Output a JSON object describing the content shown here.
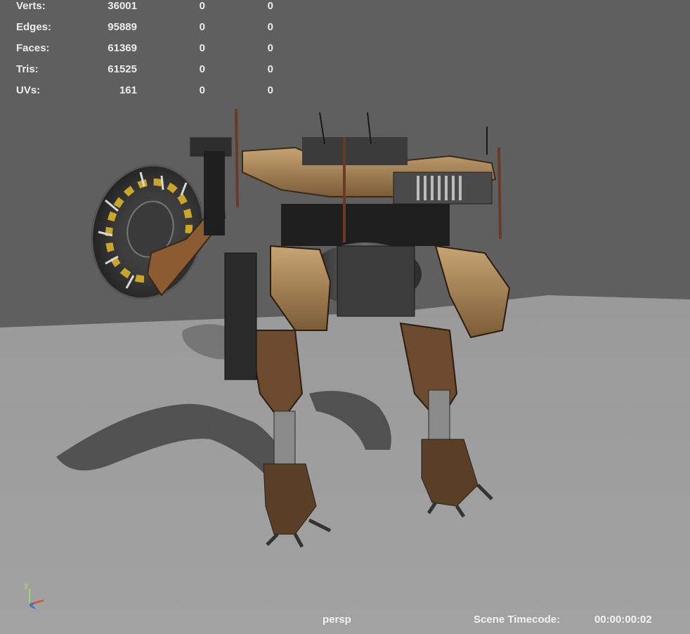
{
  "hud": {
    "rows": [
      {
        "label": "Verts:",
        "c1": "36001",
        "c2": "0",
        "c3": "0"
      },
      {
        "label": "Edges:",
        "c1": "95889",
        "c2": "0",
        "c3": "0"
      },
      {
        "label": "Faces:",
        "c1": "61369",
        "c2": "0",
        "c3": "0"
      },
      {
        "label": "Tris:",
        "c1": "61525",
        "c2": "0",
        "c3": "0"
      },
      {
        "label": "UVs:",
        "c1": "161",
        "c2": "0",
        "c3": "0"
      }
    ]
  },
  "camera": {
    "name": "persp"
  },
  "timecode": {
    "label": "Scene Timecode:",
    "value": "00:00:00:02"
  },
  "axis_gizmo": {
    "y": "y",
    "z": "z",
    "x": "x"
  },
  "colors": {
    "background": "#5f5f5f",
    "floor": "#9b9b9b",
    "hud_text": "#ececec",
    "axis_y": "#9fd37a",
    "axis_z": "#2f6fd0",
    "axis_x": "#d05a40"
  }
}
